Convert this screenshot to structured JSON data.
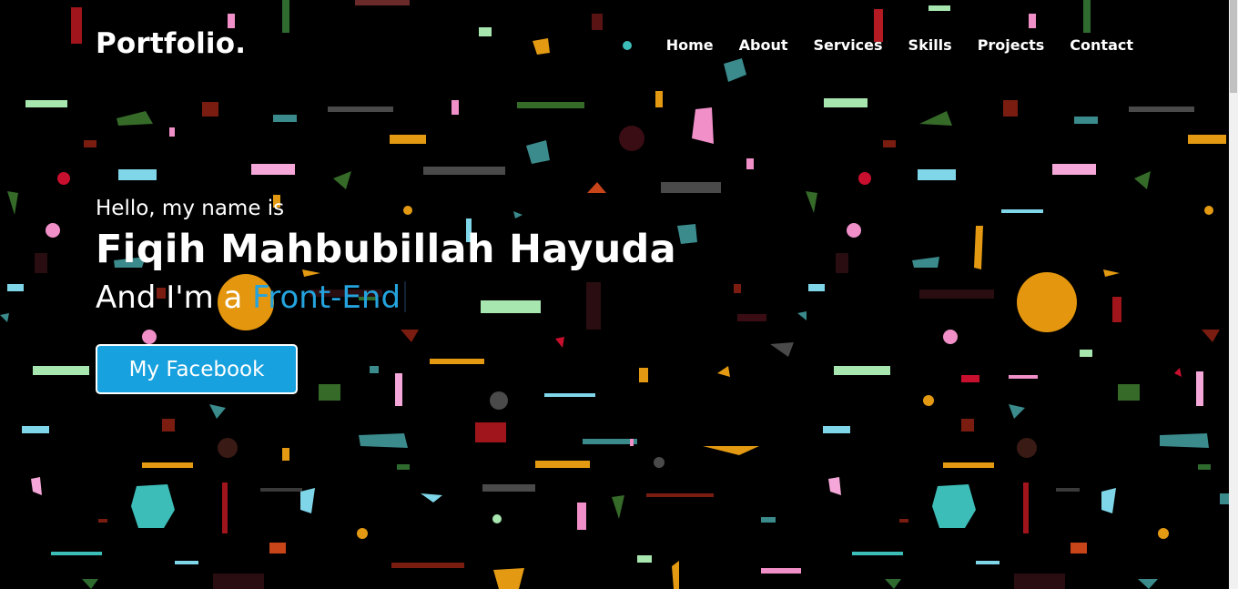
{
  "brand": {
    "logo_text": "Portfolio."
  },
  "nav": {
    "items": [
      {
        "label": "Home"
      },
      {
        "label": "About"
      },
      {
        "label": "Services"
      },
      {
        "label": "Skills"
      },
      {
        "label": "Projects"
      },
      {
        "label": "Contact"
      }
    ]
  },
  "hero": {
    "greeting": "Hello, my name is",
    "name": "Fiqih Mahbubillah Hayuda",
    "role_prefix": "And I'm a ",
    "role_typed": "Front-End",
    "cta_label": "My Facebook"
  },
  "colors": {
    "background": "#000000",
    "accent": "#24a3dd",
    "button": "#17a1de"
  }
}
